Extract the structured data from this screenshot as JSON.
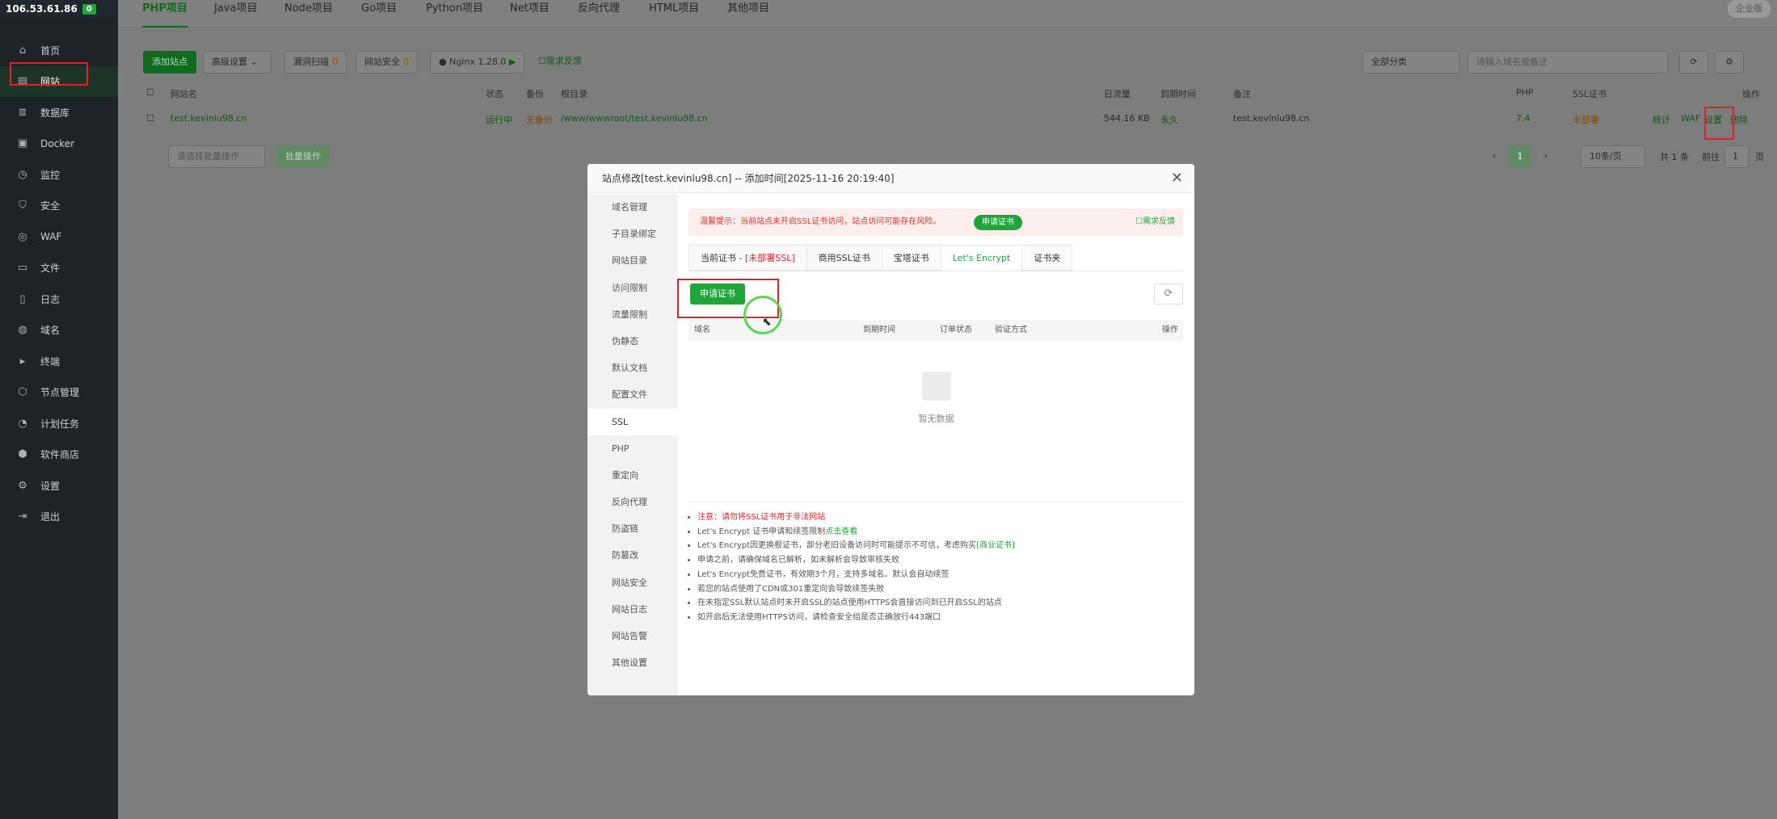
{
  "sidebar": {
    "ip": "106.53.61.86",
    "badge": "0",
    "items": [
      {
        "label": "首页",
        "icon": "home-icon"
      },
      {
        "label": "网站",
        "icon": "website-icon"
      },
      {
        "label": "数据库",
        "icon": "database-icon"
      },
      {
        "label": "Docker",
        "icon": "docker-icon"
      },
      {
        "label": "监控",
        "icon": "monitor-icon"
      },
      {
        "label": "安全",
        "icon": "shield-icon"
      },
      {
        "label": "WAF",
        "icon": "waf-icon"
      },
      {
        "label": "文件",
        "icon": "folder-icon"
      },
      {
        "label": "日志",
        "icon": "log-icon"
      },
      {
        "label": "域名",
        "icon": "globe-icon"
      },
      {
        "label": "终端",
        "icon": "terminal-icon"
      },
      {
        "label": "节点管理",
        "icon": "node-icon"
      },
      {
        "label": "计划任务",
        "icon": "clock-icon"
      },
      {
        "label": "软件商店",
        "icon": "store-icon"
      },
      {
        "label": "设置",
        "icon": "gear-icon"
      },
      {
        "label": "退出",
        "icon": "logout-icon"
      }
    ]
  },
  "project_tabs": [
    "PHP项目",
    "Java项目",
    "Node项目",
    "Go项目",
    "Python项目",
    "Net项目",
    "反向代理",
    "HTML项目",
    "其他项目"
  ],
  "enterprise": "企业版",
  "toolbar": {
    "add_site": "添加站点",
    "advanced": "高级设置",
    "expire_scan": "漏洞扫描",
    "expire_scan_count": "0",
    "site_security": "网站安全",
    "site_security_count": "0",
    "nginx": "Nginx 1.28.0",
    "feedback": "需求反馈",
    "category": "全部分类",
    "search_placeholder": "请输入域名或备注"
  },
  "table": {
    "headers": [
      "网站名",
      "状态",
      "备份",
      "根目录",
      "日流量",
      "到期时间",
      "备注",
      "PHP",
      "SSL证书",
      "操作"
    ],
    "row": {
      "name": "test.kevinlu98.cn",
      "status": "运行中",
      "backup": "无备份",
      "root": "/www/wwwroot/test.kevinlu98.cn",
      "traffic": "544.16 KB",
      "expire": "永久",
      "note": "test.kevinlu98.cn",
      "php": "7.4",
      "ssl": "未部署",
      "actions": [
        "统计",
        "WAF",
        "设置",
        "删除"
      ]
    }
  },
  "pagination": {
    "batch_placeholder": "请选择批量操作",
    "batch_button": "批量操作",
    "page": "1",
    "per_page": "10条/页",
    "total": "共 1 条",
    "goto": "前往",
    "goto_page": "1",
    "page_suffix": "页"
  },
  "modal": {
    "title": "站点修改[test.kevinlu98.cn] -- 添加时间[2025-11-16 20:19:40]",
    "menu": [
      "域名管理",
      "子目录绑定",
      "网站目录",
      "访问限制",
      "流量限制",
      "伪静态",
      "默认文档",
      "配置文件",
      "SSL",
      "PHP",
      "重定向",
      "反向代理",
      "防盗链",
      "防篡改",
      "网站安全",
      "网站日志",
      "网站告警",
      "其他设置"
    ],
    "warning": "温馨提示：当前站点未开启SSL证书访问，站点访问可能存在风险。",
    "warning_apply": "申请证书",
    "feedback": "需求反馈",
    "ssl_tabs": {
      "current_prefix": "当前证书 - ",
      "current_status": "[未部署SSL]",
      "commercial": "商用SSL证书",
      "baota": "宝塔证书",
      "letsencrypt": "Let's Encrypt",
      "folder": "证书夹"
    },
    "apply_cert": "申请证书",
    "cert_columns": [
      "域名",
      "到期时间",
      "订单状态",
      "验证方式",
      "操作"
    ],
    "empty_text": "暂无数据",
    "notes": [
      {
        "text": "注意：请勿将SSL证书用于非法网站",
        "red": true
      },
      {
        "text": "Let's Encrypt 证书申请和续签限制",
        "link": "点击查看"
      },
      {
        "text": "Let's Encrypt因更换根证书，部分老旧设备访问时可能提示不可信，考虑购买",
        "link": "[商业证书]"
      },
      {
        "text": "申请之前，请确保域名已解析，如未解析会导致审核失败"
      },
      {
        "text": "Let's Encrypt免费证书，有效期3个月，支持多域名。默认会自动续签"
      },
      {
        "text": "若您的站点使用了CDN或301重定向会导致续签失败"
      },
      {
        "text": "在未指定SSL默认站点时未开启SSL的站点使用HTTPS会直接访问到已开启SSL的站点"
      },
      {
        "text": "如开启后无法使用HTTPS访问，请检查安全组是否正确放行443端口"
      }
    ]
  }
}
